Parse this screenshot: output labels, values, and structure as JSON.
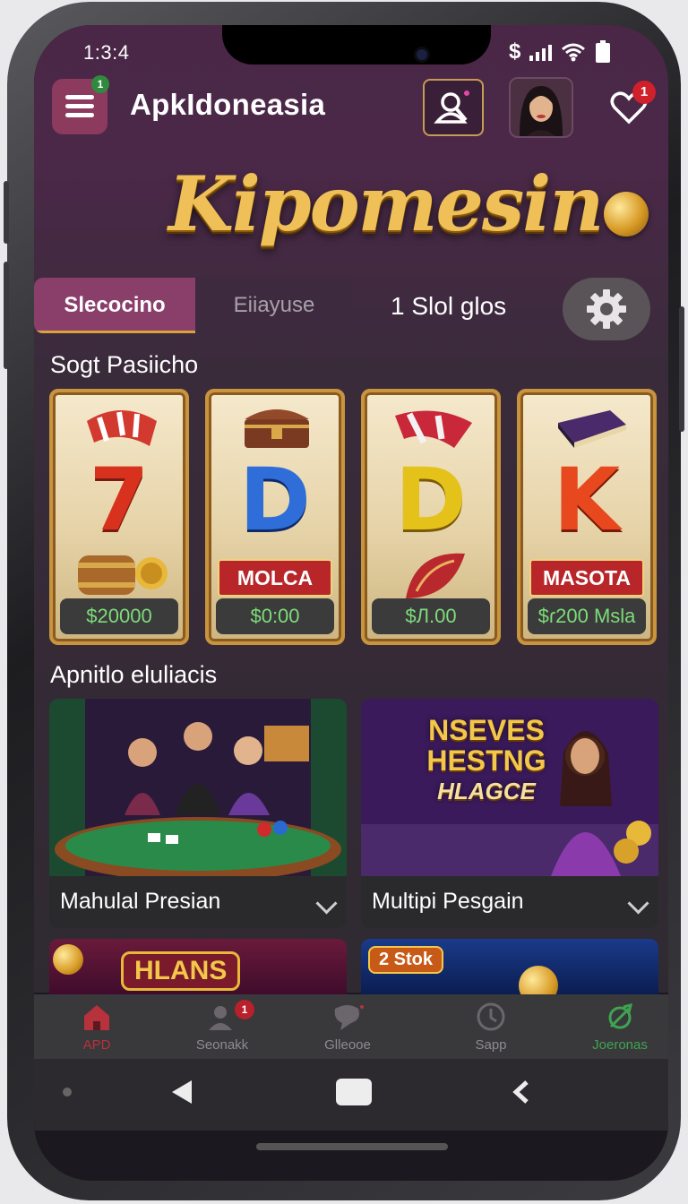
{
  "status_bar": {
    "time": "1:3:4",
    "currency_icon": "$"
  },
  "header": {
    "app_title": "ApkIdoneasia",
    "menu_badge": "1",
    "favorites_badge": "1"
  },
  "logo": {
    "text": "Kipomesin"
  },
  "tabs": [
    {
      "label": "Slecocino",
      "active": true
    },
    {
      "label": "Eiiayuse",
      "active": false
    }
  ],
  "slot_count_label": "1 Slol glos",
  "slots_section": {
    "title": "Sogt Pasiicho",
    "cards": [
      {
        "symbol": "7",
        "symbol_color": "#d8321e",
        "band": "",
        "price": "$20000"
      },
      {
        "symbol": "D",
        "symbol_color": "#2f6ed8",
        "band": "MOLCA",
        "price": "$0:00"
      },
      {
        "symbol": "D",
        "symbol_color": "#e5c21a",
        "band": "",
        "price": "$Л.00"
      },
      {
        "symbol": "K",
        "symbol_color": "#e8481e",
        "band": "MASOTA",
        "price": "$ɾ200 Msla"
      }
    ]
  },
  "live_section": {
    "title": "Apnitlo eluliacis",
    "cards": [
      {
        "name": "Mahulal Presian"
      },
      {
        "name": "Multipi Pesgain",
        "banner": [
          "NSEVES",
          "HESTNG",
          "HLAGCE"
        ]
      }
    ]
  },
  "promos": [
    {
      "text": "HLANS"
    },
    {
      "text": "2 Stok"
    }
  ],
  "bottom_nav": [
    {
      "label": "APD",
      "icon": "home-icon",
      "color": "#b8323c",
      "badge": ""
    },
    {
      "label": "Seonakk",
      "icon": "user-search-icon",
      "color": "#8f8a90",
      "badge": "1"
    },
    {
      "label": "Glleooe",
      "icon": "chat-icon",
      "color": "#8f8a90",
      "badge": ""
    },
    {
      "label": "Sapp",
      "icon": "clock-icon",
      "color": "#8f8a90",
      "badge": ""
    },
    {
      "label": "Joeronas",
      "icon": "leaf-icon",
      "color": "#3fa452",
      "badge": ""
    }
  ],
  "colors": {
    "accent": "#8a3e6a",
    "gold": "#d9a23d",
    "price_green": "#7ddc7a"
  }
}
